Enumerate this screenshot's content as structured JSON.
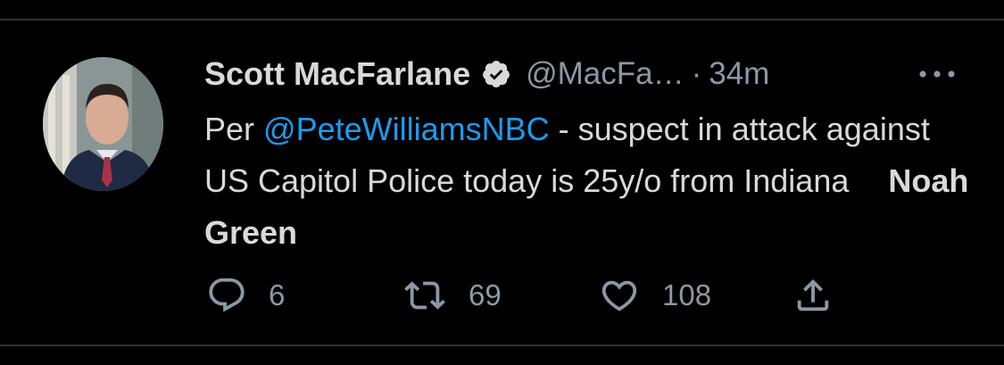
{
  "author": {
    "name": "Scott MacFarlane",
    "handle": "@MacFa…",
    "separator": "·",
    "time": "34m",
    "verified": true
  },
  "tweet": {
    "prefix": "Per ",
    "mention": "@PeteWilliamsNBC",
    "text": " - suspect in attack against US Capitol Police today is 25y/o from Indiana",
    "bold_suffix": "Noah Green"
  },
  "actions": {
    "replies": "6",
    "retweets": "69",
    "likes": "108"
  },
  "icons": [
    "verified-icon",
    "more-icon",
    "reply-icon",
    "retweet-icon",
    "like-icon",
    "share-icon"
  ],
  "colors": {
    "background": "#000000",
    "text": "#d9d9d9",
    "secondary": "#8b98a5",
    "mention": "#1d9bf0",
    "divider": "#2f3336"
  }
}
